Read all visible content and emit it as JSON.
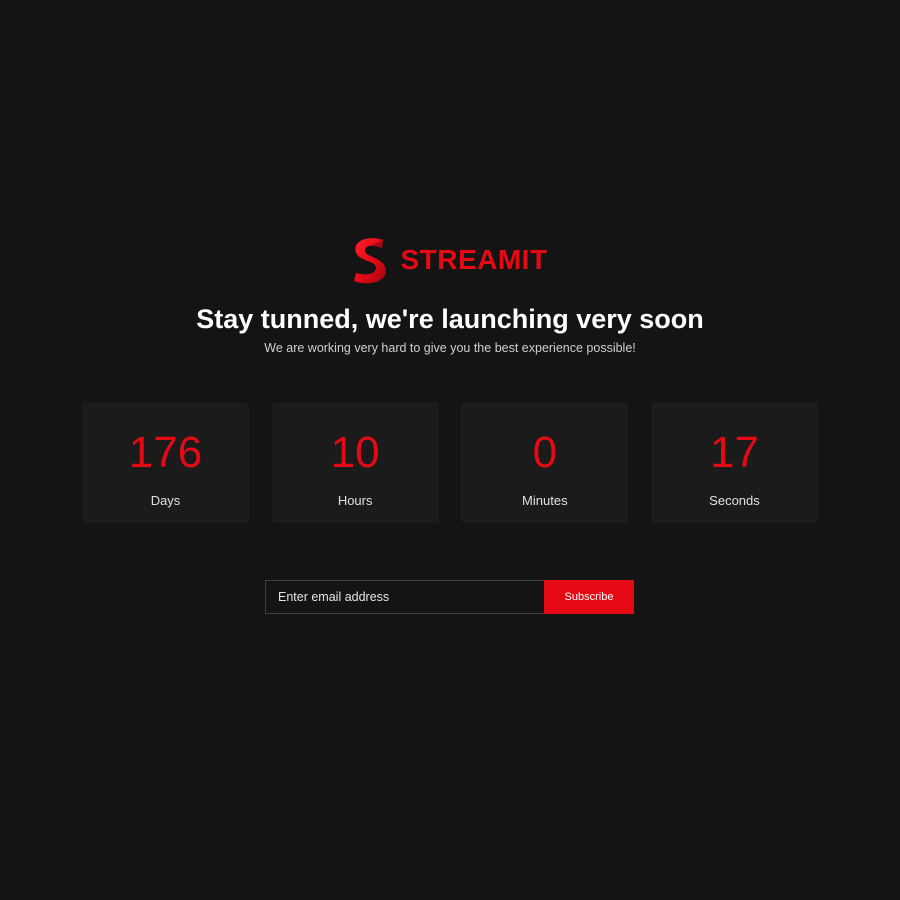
{
  "brand": {
    "name": "STREAMIT",
    "logo_icon": "streamit-s-logo-icon",
    "accent_color": "#e50914"
  },
  "hero": {
    "headline": "Stay tunned, we're launching very soon",
    "subline": "We are working very hard to give you the best experience possible!"
  },
  "countdown": [
    {
      "value": "176",
      "label": "Days"
    },
    {
      "value": "10",
      "label": "Hours"
    },
    {
      "value": "0",
      "label": "Minutes"
    },
    {
      "value": "17",
      "label": "Seconds"
    }
  ],
  "subscribe": {
    "placeholder": "Enter email address",
    "button_label": "Subscribe"
  },
  "colors": {
    "background": "#141414",
    "card": "#1b1b1b",
    "accent": "#e50914"
  }
}
